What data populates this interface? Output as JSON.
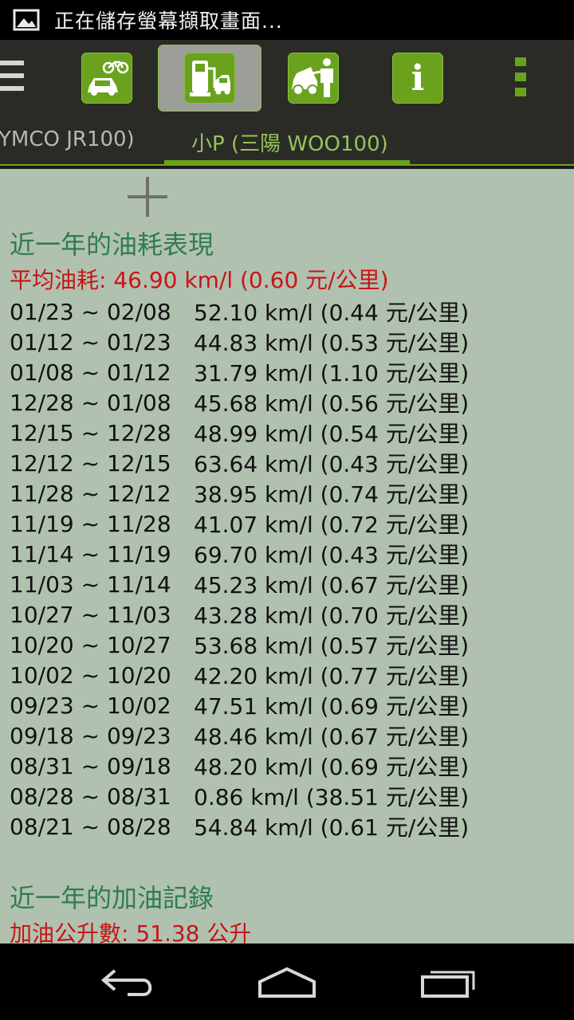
{
  "status_bar": {
    "icon": "picture-icon",
    "text": "正在儲存螢幕擷取畫面..."
  },
  "action_bar": {
    "menu_icon": "menu-icon",
    "nav_items": [
      {
        "icon": "motorcycle-car-icon"
      },
      {
        "icon": "fuel-pump-icon",
        "selected": true
      },
      {
        "icon": "car-repair-icon"
      },
      {
        "icon": "info-icon",
        "label": "i"
      }
    ],
    "overflow_icon": "overflow-menu-icon",
    "colors": {
      "accent": "#6aa21e",
      "bar_bg": "#2a2b27"
    }
  },
  "tabs": [
    {
      "label": "YMCO JR100)"
    },
    {
      "label": "小P (三陽 WOO100)",
      "active": true
    }
  ],
  "content": {
    "add_icon": "plus-icon",
    "fuel_section": {
      "title": "近一年的油耗表現",
      "average": "平均油耗: 46.90 km/l (0.60 元/公里)",
      "records": [
        {
          "range": "01/23 ~ 02/08",
          "value": "52.10 km/l (0.44 元/公里)"
        },
        {
          "range": "01/12 ~ 01/23",
          "value": "44.83 km/l (0.53 元/公里)"
        },
        {
          "range": "01/08 ~ 01/12",
          "value": "31.79 km/l (1.10 元/公里)"
        },
        {
          "range": "12/28 ~ 01/08",
          "value": "45.68 km/l (0.56 元/公里)"
        },
        {
          "range": "12/15 ~ 12/28",
          "value": "48.99 km/l (0.54 元/公里)"
        },
        {
          "range": "12/12 ~ 12/15",
          "value": "63.64 km/l (0.43 元/公里)"
        },
        {
          "range": "11/28 ~ 12/12",
          "value": "38.95 km/l (0.74 元/公里)"
        },
        {
          "range": "11/19 ~ 11/28",
          "value": "41.07 km/l (0.72 元/公里)"
        },
        {
          "range": "11/14 ~ 11/19",
          "value": "69.70 km/l (0.43 元/公里)"
        },
        {
          "range": "11/03 ~ 11/14",
          "value": "45.23 km/l (0.67 元/公里)"
        },
        {
          "range": "10/27 ~ 11/03",
          "value": "43.28 km/l (0.70 元/公里)"
        },
        {
          "range": "10/20 ~ 10/27",
          "value": "53.68 km/l (0.57 元/公里)"
        },
        {
          "range": "10/02 ~ 10/20",
          "value": "42.20 km/l (0.77 元/公里)"
        },
        {
          "range": "09/23 ~ 10/02",
          "value": "47.51 km/l (0.69 元/公里)"
        },
        {
          "range": "09/18 ~ 09/23",
          "value": "48.46 km/l (0.67 元/公里)"
        },
        {
          "range": "08/31 ~ 09/18",
          "value": "48.20 km/l (0.69 元/公里)"
        },
        {
          "range": "08/28 ~ 08/31",
          "value": "0.86 km/l (38.51 元/公里)"
        },
        {
          "range": "08/21 ~ 08/28",
          "value": "54.84 km/l (0.61 元/公里)"
        }
      ]
    },
    "refuel_section": {
      "title": "近一年的加油記錄",
      "total": "加油公升數: 51.38 公升"
    },
    "colors": {
      "title": "#2e7d4f",
      "summary": "#c81414",
      "background": "#b1c1b0"
    }
  },
  "nav_bar": {
    "back_icon": "back-icon",
    "home_icon": "home-icon",
    "recents_icon": "recents-icon"
  }
}
